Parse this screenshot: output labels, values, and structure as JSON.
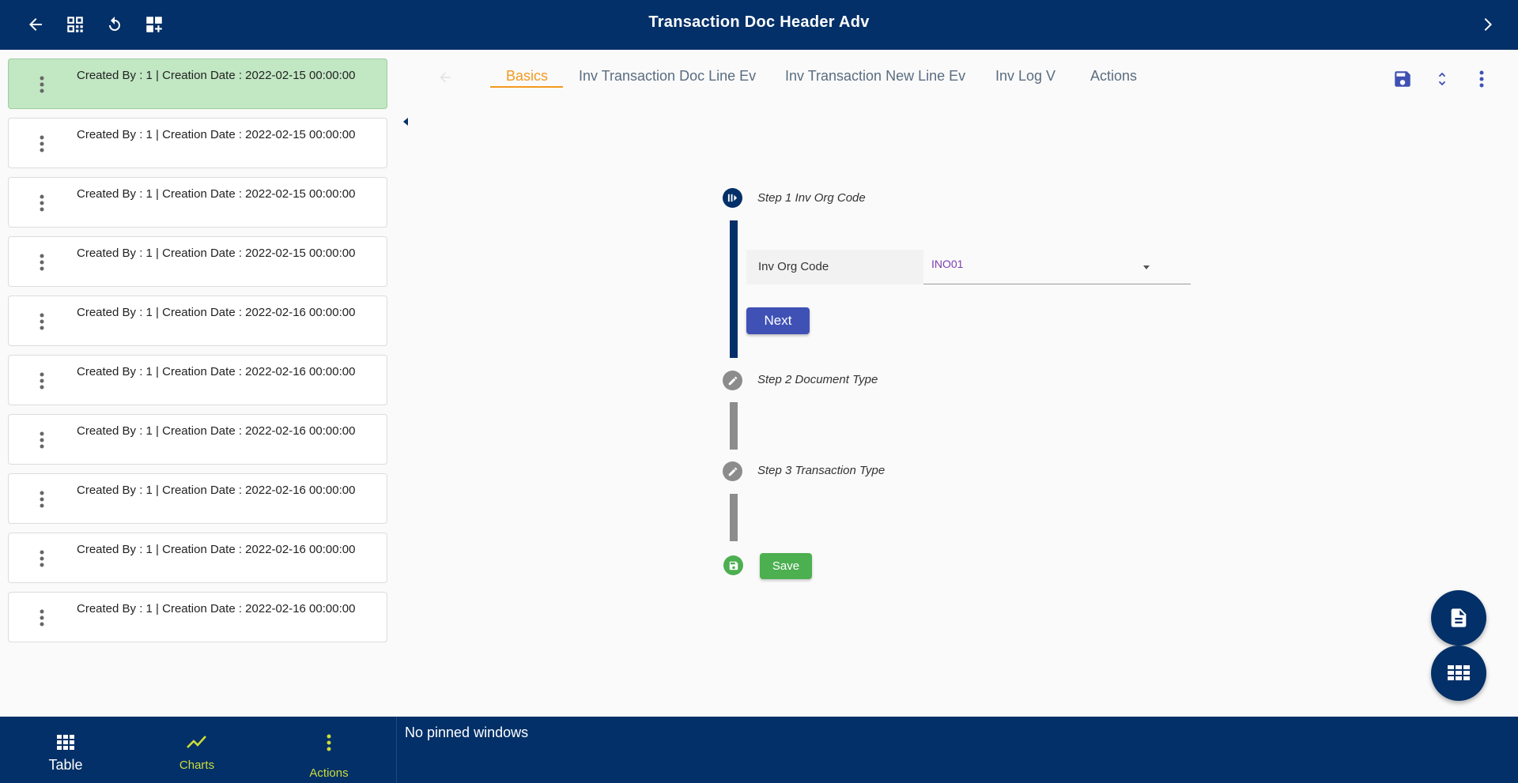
{
  "header": {
    "title": "Transaction Doc Header  Adv",
    "icons": [
      "back-arrow-icon",
      "dashboard-icon",
      "refresh-icon",
      "add-widget-icon",
      "chevron-right-icon"
    ]
  },
  "records": [
    {
      "text": "Created By  : 1 | Creation Date  : 2022-02-15 00:00:00",
      "selected": true
    },
    {
      "text": "Created By  : 1 | Creation Date  : 2022-02-15 00:00:00"
    },
    {
      "text": "Created By  : 1 | Creation Date  : 2022-02-15 00:00:00"
    },
    {
      "text": "Created By  : 1 | Creation Date  : 2022-02-15 00:00:00"
    },
    {
      "text": "Created By  : 1 | Creation Date  : 2022-02-16 00:00:00"
    },
    {
      "text": "Created By  : 1 | Creation Date  : 2022-02-16 00:00:00"
    },
    {
      "text": "Created By  : 1 | Creation Date  : 2022-02-16 00:00:00"
    },
    {
      "text": "Created By  : 1 | Creation Date  : 2022-02-16 00:00:00"
    },
    {
      "text": "Created By  : 1 | Creation Date  : 2022-02-16 00:00:00"
    },
    {
      "text": "Created By  : 1 | Creation Date  : 2022-02-16 00:00:00"
    }
  ],
  "tabs": [
    {
      "label": "Basics",
      "active": true
    },
    {
      "label": "Inv Transaction Doc Line Ev"
    },
    {
      "label": "Inv Transaction New Line Ev"
    },
    {
      "label": "Inv Log V"
    },
    {
      "label": "Actions"
    }
  ],
  "stepper": {
    "steps": [
      {
        "label": "Step 1  Inv Org Code",
        "state": "active"
      },
      {
        "label": "Step 2 Document Type",
        "state": "pending"
      },
      {
        "label": "Step 3 Transaction Type",
        "state": "pending"
      }
    ],
    "field": {
      "label": "Inv Org Code",
      "value": "INO01"
    },
    "next_label": "Next",
    "save_label": "Save"
  },
  "bottom_nav": [
    {
      "label": "Table",
      "icon": "table-icon"
    },
    {
      "label": "Charts",
      "icon": "chart-line-icon"
    },
    {
      "label": "Actions",
      "icon": "more-vert-icon"
    }
  ],
  "pinned_text": "No pinned windows",
  "colors": {
    "primary": "#033068",
    "accent_tab": "#f39a1e",
    "selected_row": "#c2e7c3",
    "next_button": "#3f51b5",
    "save_green": "#4caf50",
    "chart_nav_active": "#cddc39"
  }
}
